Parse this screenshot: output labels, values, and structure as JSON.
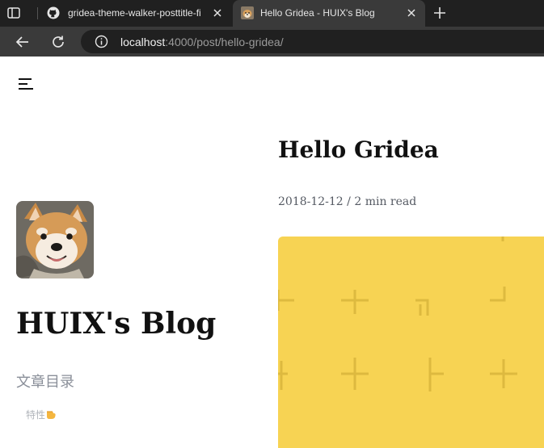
{
  "browser": {
    "tabs": [
      {
        "title": "gridea-theme-walker-posttitle-fi",
        "icon": "github-icon",
        "active": false
      },
      {
        "title": "Hello Gridea - HUIX's Blog",
        "icon": "dog-favicon",
        "active": true
      }
    ],
    "address": {
      "host": "localhost",
      "rest": ":4000/post/hello-gridea/"
    },
    "colors": {
      "tabbar": "#202020",
      "toolbar": "#3a3a3a"
    }
  },
  "sidebar": {
    "blog_title": "HUIX's Blog",
    "toc_title": "文章目录",
    "toc_items": [
      {
        "label": "特性"
      }
    ]
  },
  "post": {
    "title": "Hello Gridea",
    "meta": "2018-12-12 / 2 min read",
    "feature_color": "#f7d353"
  }
}
